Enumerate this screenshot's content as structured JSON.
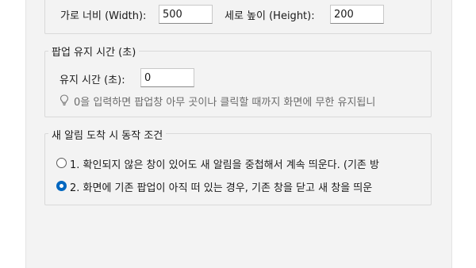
{
  "size": {
    "width_label": "가로 너비 (Width):",
    "width_value": "500",
    "height_label": "세로 높이 (Height):",
    "height_value": "200"
  },
  "popup_duration": {
    "title": "팝업 유지 시간 (초)",
    "label": "유지 시간 (초):",
    "value": "0",
    "hint": "0을 입력하면 팝업창 아무 곳이나 클릭할 때까지 화면에 무한 유지됩니",
    "hint_icon": "lightbulb-icon"
  },
  "new_alert_behavior": {
    "title": "새 알림 도착 시 동작 조건",
    "options": [
      {
        "label": "1. 확인되지 않은 창이 있어도 새 알림을 중첩해서 계속 띄운다. (기존 방",
        "checked": false
      },
      {
        "label": "2. 화면에 기존 팝업이 아직 떠 있는 경우, 기존 창을 닫고 새 창을 띄운",
        "checked": true
      }
    ]
  },
  "colors": {
    "accent": "#0067c0",
    "panel_bg": "#f3f3f3",
    "hint_text": "#6b6b6b"
  }
}
